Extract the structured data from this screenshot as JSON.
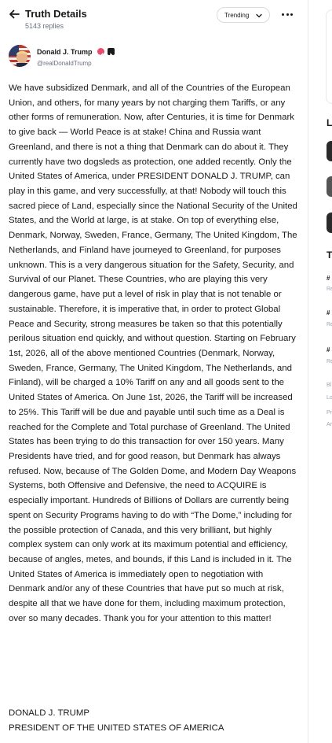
{
  "header": {
    "title": "Truth Details",
    "reply_count": "5143 replies",
    "sort_label": "Trending"
  },
  "author": {
    "name": "Donald J. Trump",
    "handle": "@realDonaldTrump"
  },
  "post": {
    "body": "We have subsidized Denmark, and all of the Countries of the European Union, and others, for many years by not charging them Tariffs, or any other forms of remuneration. Now, after Centuries, it is time for Denmark to give back — World Peace is at stake! China and Russia want Greenland, and there is not a thing that Denmark can do about it. They currently have two dogsleds as protection, one added recently. Only the United States of America, under PRESIDENT DONALD J. TRUMP, can play in this game, and very successfully, at that! Nobody will touch this sacred piece of Land, especially since the National Security of the United States, and the World at large, is at stake. On top of everything else, Denmark, Norway, Sweden, France, Germany, The United Kingdom, The Netherlands, and Finland have journeyed to Greenland, for purposes unknown. This is a very dangerous situation for the Safety, Security, and Survival of our Planet. These Countries, who are playing this very dangerous game, have put a level of risk in play that is not tenable or sustainable. Therefore, it is imperative that, in order to protect Global Peace and Security, strong measures be taken so that this potentially perilous situation end quickly, and without question. Starting on February 1st, 2026, all of the above mentioned Countries (Denmark, Norway, Sweden, France, Germany, The United Kingdom, The Netherlands, and Finland), will be charged a 10% Tariff on any and all goods sent to the United States of America. On June 1st, 2026, the Tariff will be increased to 25%. This Tariff will be due and payable until such time as a Deal is reached for the Complete and Total purchase of Greenland. The United States has been trying to do this transaction for over 150 years. Many Presidents have tried, and for good reason, but Denmark has always refused. Now, because of The Golden Dome, and Modern Day Weapons Systems, both Offensive and Defensive, the need to ACQUIRE is especially important. Hundreds of Billions of Dollars are currently being spent on Security Programs having to do with “The Dome,” including for the possible protection of Canada, and this very brilliant, but highly complex system can only work at its maximum potential and efficiency, because of angles, metes, and bounds, if this Land is included in it. The United States of America is immediately open to negotiation with Denmark and/or any of these Countries that have put so much at risk, despite all that we have done for them, including maximum protection, over so many decades. Thank you for your attention to this matter!",
    "signature_line1": "DONALD J. TRUMP",
    "signature_line2": "PRESIDENT OF THE UNITED STATES OF AMERICA"
  },
  "right_column": {
    "heading_1": "L",
    "heading_2": "T",
    "tags": [
      "#",
      "#",
      "#"
    ],
    "subs": [
      "Re",
      "Re",
      "Re"
    ],
    "footer": [
      "Bl",
      "Lo",
      "Pr",
      "Ar"
    ]
  },
  "colors": {
    "accent_pink": "#ea4c6d",
    "text_primary": "#1a1a1a",
    "text_secondary": "#6b7280",
    "divider": "#e6e8ec"
  },
  "icons": {
    "back": "arrow-left-icon",
    "sort": "chevron-down-icon",
    "more": "ellipsis-icon",
    "verified": "verified-badge-icon"
  }
}
